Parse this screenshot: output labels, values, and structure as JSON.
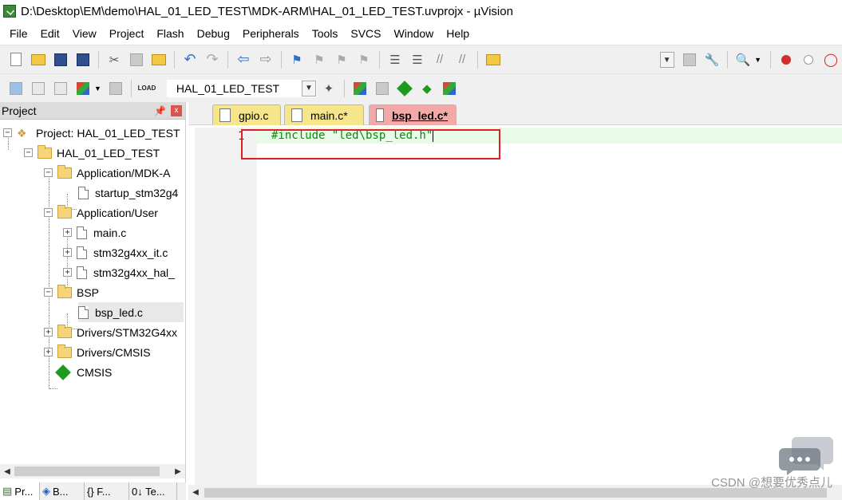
{
  "window": {
    "title": "D:\\Desktop\\EM\\demo\\HAL_01_LED_TEST\\MDK-ARM\\HAL_01_LED_TEST.uvprojx - µVision"
  },
  "menu": [
    "File",
    "Edit",
    "View",
    "Project",
    "Flash",
    "Debug",
    "Peripherals",
    "Tools",
    "SVCS",
    "Window",
    "Help"
  ],
  "toolbar2": {
    "target_value": "HAL_01_LED_TEST",
    "load_label": "LOAD"
  },
  "project_panel": {
    "title": "Project",
    "close_label": "x",
    "tree": {
      "project": "Project: HAL_01_LED_TEST",
      "target": "HAL_01_LED_TEST",
      "group_app_mdk": "Application/MDK-A",
      "file_startup": "startup_stm32g4",
      "group_app_user": "Application/User",
      "file_main": "main.c",
      "file_it": "stm32g4xx_it.c",
      "file_hal": "stm32g4xx_hal_",
      "group_bsp": "BSP",
      "file_bsp_led": "bsp_led.c",
      "group_drivers_stm": "Drivers/STM32G4xx",
      "group_drivers_cmsis": "Drivers/CMSIS",
      "cmsis": "CMSIS"
    },
    "bottom_tabs": [
      "Pr...",
      "B...",
      "{} F...",
      "0↓ Te..."
    ]
  },
  "editor": {
    "tabs": [
      "gpio.c",
      "main.c*",
      "bsp_led.c*"
    ],
    "active_tab": "bsp_led.c*",
    "line_number": "1",
    "code_line_1": "#include \"led\\bsp_led.h\""
  },
  "watermark": "CSDN @想要优秀点儿",
  "colors": {
    "tab_yellow": "#f7e58c",
    "tab_active_red": "#f4a8a8",
    "code_green": "#0a8a0a",
    "highlight_red": "#e02020",
    "current_line": "#e8fbe8"
  }
}
